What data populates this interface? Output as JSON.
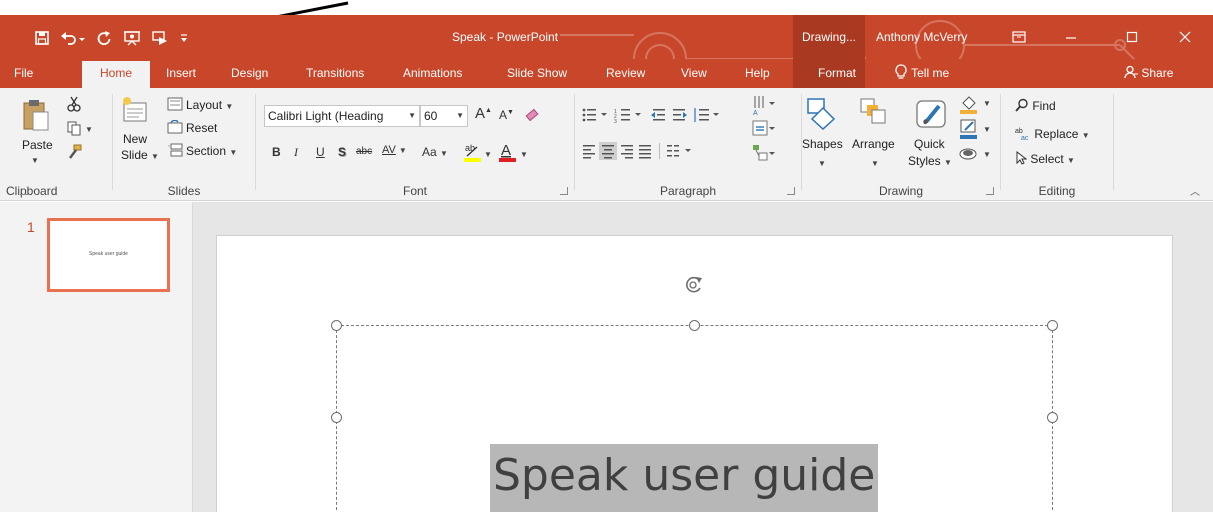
{
  "window": {
    "title": "Speak - PowerPoint",
    "context_tool": "Drawing...",
    "user": "Anthony McVerry",
    "share": "Share"
  },
  "tabs": [
    "File",
    "Home",
    "Insert",
    "Design",
    "Transitions",
    "Animations",
    "Slide Show",
    "Review",
    "View",
    "Help",
    "Format"
  ],
  "tell_me": "Tell me",
  "ribbon": {
    "clipboard": {
      "label": "Clipboard",
      "paste": "Paste"
    },
    "slides": {
      "label": "Slides",
      "new_slide_1": "New",
      "new_slide_2": "Slide",
      "layout": "Layout",
      "reset": "Reset",
      "section": "Section"
    },
    "font": {
      "label": "Font",
      "family": "Calibri Light (Heading",
      "size": "60",
      "bold": "B",
      "italic": "I",
      "underline": "U",
      "shadow": "S",
      "strike": "abc",
      "spacing": "AV",
      "case": "Aa"
    },
    "paragraph": {
      "label": "Paragraph"
    },
    "drawing": {
      "label": "Drawing",
      "shapes": "Shapes",
      "arrange": "Arrange",
      "quick_1": "Quick",
      "quick_2": "Styles"
    },
    "editing": {
      "label": "Editing",
      "find": "Find",
      "replace": "Replace",
      "select": "Select"
    }
  },
  "thumbnails": [
    {
      "number": "1",
      "text": "Speak user guide"
    }
  ],
  "slide": {
    "title": "Speak user guide"
  },
  "colors": {
    "accent": "#c8472a",
    "ribbon": "#f2f2f2",
    "selection": "#b7b7b7"
  }
}
